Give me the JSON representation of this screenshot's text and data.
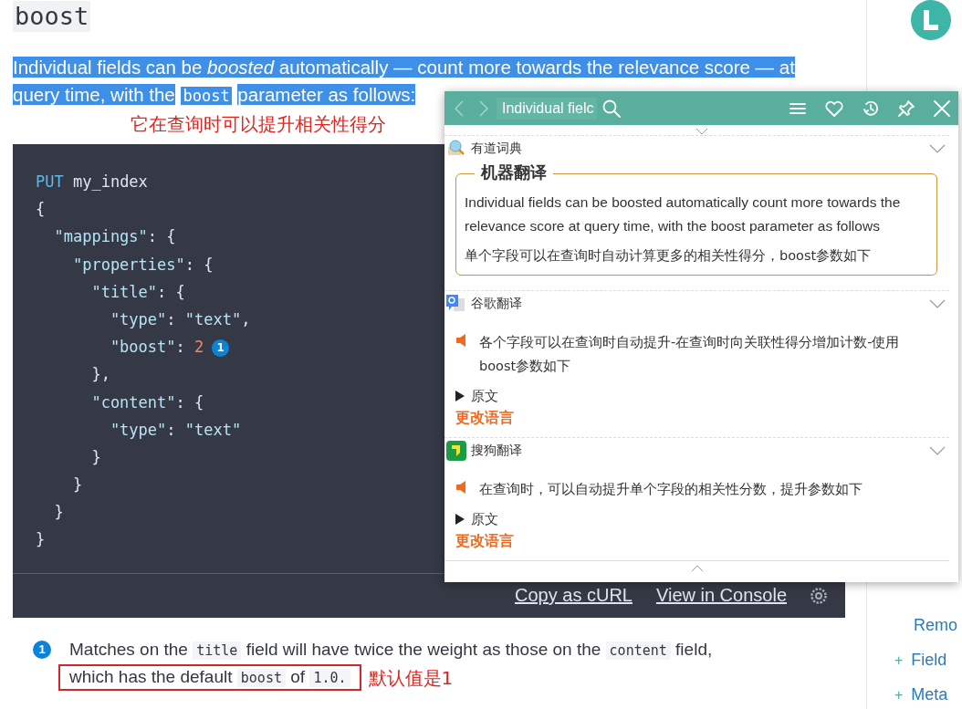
{
  "heading": "boost",
  "intro": [
    {
      "kind": "text",
      "text": "Individual fields can be *boosted* automatically — count more towards the relevance score — at query time, with the"
    },
    {
      "kind": "code",
      "text": "boost"
    },
    {
      "kind": "text",
      "text": "parameter as follows:"
    }
  ],
  "intro_note": "它在查询时可以提升相关性得分",
  "code_lines": [
    [
      {
        "kind": "kw",
        "text": "PUT"
      },
      {
        "kind": "name",
        "text": " my_index"
      }
    ],
    [
      {
        "kind": "punct",
        "text": "{"
      }
    ],
    [
      {
        "kind": "key",
        "text": "  \"mappings\""
      },
      {
        "kind": "punct",
        "text": ": {"
      }
    ],
    [
      {
        "kind": "key",
        "text": "    \"properties\""
      },
      {
        "kind": "punct",
        "text": ": {"
      }
    ],
    [
      {
        "kind": "key",
        "text": "      \"title\""
      },
      {
        "kind": "punct",
        "text": ": {"
      }
    ],
    [
      {
        "kind": "key",
        "text": "        \"type\""
      },
      {
        "kind": "punct",
        "text": ": "
      },
      {
        "kind": "key",
        "text": "\"text\""
      },
      {
        "kind": "punct",
        "text": ","
      }
    ],
    [
      {
        "kind": "key",
        "text": "        \"boost\""
      },
      {
        "kind": "punct",
        "text": ": "
      },
      {
        "kind": "num",
        "text": "2"
      },
      {
        "kind": "callout",
        "text": "1"
      }
    ],
    [
      {
        "kind": "punct",
        "text": "      },"
      }
    ],
    [
      {
        "kind": "key",
        "text": "      \"content\""
      },
      {
        "kind": "punct",
        "text": ": {"
      }
    ],
    [
      {
        "kind": "key",
        "text": "        \"type\""
      },
      {
        "kind": "punct",
        "text": ": "
      },
      {
        "kind": "key",
        "text": "\"text\""
      }
    ],
    [
      {
        "kind": "punct",
        "text": "      }"
      }
    ],
    [
      {
        "kind": "punct",
        "text": "    }"
      }
    ],
    [
      {
        "kind": "punct",
        "text": "  }"
      }
    ],
    [
      {
        "kind": "punct",
        "text": "}"
      }
    ]
  ],
  "code_actions": [
    "Copy as cURL",
    "View in Console"
  ],
  "callout": {
    "number": "1",
    "line1": [
      {
        "kind": "text",
        "text": "Matches on the"
      },
      {
        "kind": "code",
        "text": "title"
      },
      {
        "kind": "text",
        "text": "field will have twice the weight as those on the"
      },
      {
        "kind": "code",
        "text": "content"
      },
      {
        "kind": "text",
        "text": "field,"
      }
    ],
    "line2": [
      {
        "kind": "text",
        "text": "which has the default"
      },
      {
        "kind": "code",
        "text": "boost"
      },
      {
        "kind": "text",
        "text": "of"
      },
      {
        "kind": "code",
        "text": "1.0."
      }
    ],
    "note": "默认值是1"
  },
  "sidebar": {
    "items": [
      {
        "label": "Remo"
      },
      {
        "marker": "+",
        "label": "Field"
      },
      {
        "marker": "+",
        "label": "Meta"
      }
    ]
  },
  "popup": {
    "search": {
      "value": "Individual fielc"
    },
    "sections": [
      {
        "kind": "machine",
        "title": "有道词典",
        "legend": "机器翻译",
        "source": "Individual fields can be boosted automatically count more towards the relevance score at query time, with the boost parameter as follows",
        "translation": "单个字段可以在查询时自动计算更多的相关性得分，boost参数如下"
      },
      {
        "kind": "result",
        "title": "谷歌翻译",
        "translation": "各个字段可以在查询时自动提升-在查询时向关联性得分增加计数-使用boost参数如下",
        "original_toggle": "原文",
        "change_language": "更改语言"
      },
      {
        "kind": "result",
        "title": "搜狗翻译",
        "translation": "在查询时，可以自动提升单个字段的相关性分数，提升参数如下",
        "original_toggle": "原文",
        "change_language": "更改语言"
      }
    ]
  }
}
